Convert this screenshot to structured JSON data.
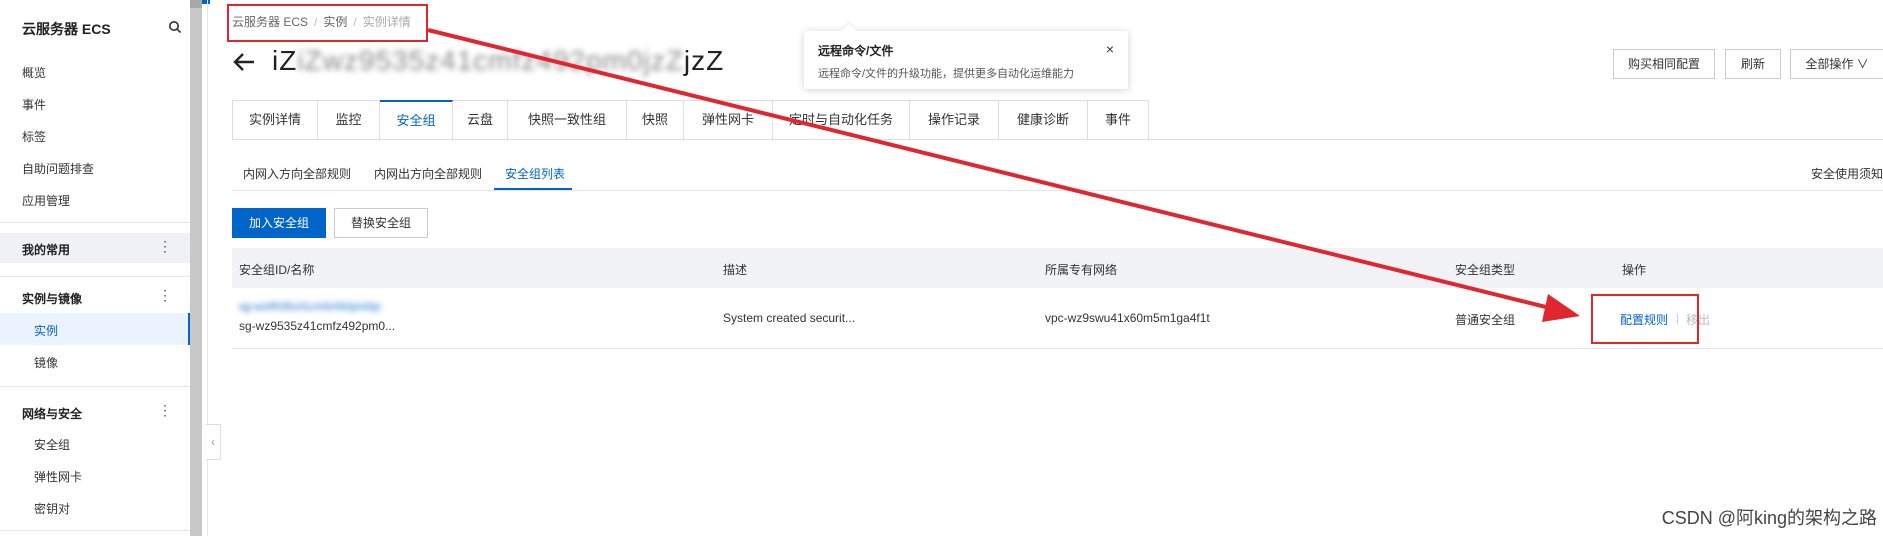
{
  "sidebar": {
    "title": "云服务器 ECS",
    "items": [
      "概览",
      "事件",
      "标签",
      "自助问题排查",
      "应用管理"
    ],
    "groups": [
      {
        "label": "我的常用",
        "more": "⋮"
      },
      {
        "label": "实例与镜像",
        "more": "⋮",
        "children": [
          "实例",
          "镜像"
        ]
      },
      {
        "label": "网络与安全",
        "more": "⋮",
        "children": [
          "安全组",
          "弹性网卡",
          "密钥对"
        ]
      }
    ],
    "collapse": "‹"
  },
  "breadcrumb": [
    "云服务器 ECS",
    "实例",
    "实例详情"
  ],
  "instance": {
    "title": "iZwz9535z41cmfz492pm0jzZ",
    "title_visible": "iZ",
    "title_tail": "jzZ"
  },
  "tooltip": {
    "title": "远程命令/文件",
    "body": "远程命令/文件的升级功能，提供更多自动化运维能力",
    "close": "×"
  },
  "header_buttons": {
    "buy_same": "购买相同配置",
    "refresh": "刷新",
    "all_ops": "全部操作 ∨"
  },
  "tabs": [
    "实例详情",
    "监控",
    "安全组",
    "云盘",
    "快照一致性组",
    "快照",
    "弹性网卡",
    "定时与自动化任务",
    "操作记录",
    "健康诊断",
    "事件"
  ],
  "active_tab": "安全组",
  "subtabs": [
    "内网入方向全部规则",
    "内网出方向全部规则",
    "安全组列表"
  ],
  "active_subtab": "安全组列表",
  "right_link": "安全使用须知",
  "actions": {
    "add": "加入安全组",
    "replace": "替换安全组"
  },
  "table": {
    "headers": [
      "安全组ID/名称",
      "描述",
      "所属专有网络",
      "安全组类型",
      "操作"
    ],
    "rows": [
      {
        "name": "sg-wz9535z41cmfz492pm0jz",
        "id": "sg-wz9535z41cmfz492pm0...",
        "desc": "System created securit...",
        "vpc": "vpc-wz9swu41x60m5m1ga4f1t",
        "type": "普通安全组",
        "op_config": "配置规则",
        "op_remove": "移出"
      }
    ]
  },
  "watermark": "CSDN @阿king的架构之路",
  "colors": {
    "accent": "#0064c8",
    "annotation_red": "#e0262e"
  }
}
